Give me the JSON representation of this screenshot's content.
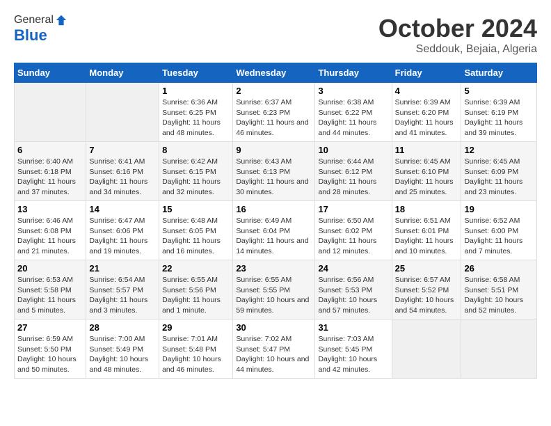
{
  "header": {
    "logo_line1": "General",
    "logo_line2": "Blue",
    "month": "October 2024",
    "location": "Seddouk, Bejaia, Algeria"
  },
  "days_of_week": [
    "Sunday",
    "Monday",
    "Tuesday",
    "Wednesday",
    "Thursday",
    "Friday",
    "Saturday"
  ],
  "weeks": [
    [
      {
        "day": "",
        "sunrise": "",
        "sunset": "",
        "daylight": ""
      },
      {
        "day": "",
        "sunrise": "",
        "sunset": "",
        "daylight": ""
      },
      {
        "day": "1",
        "sunrise": "Sunrise: 6:36 AM",
        "sunset": "Sunset: 6:25 PM",
        "daylight": "Daylight: 11 hours and 48 minutes."
      },
      {
        "day": "2",
        "sunrise": "Sunrise: 6:37 AM",
        "sunset": "Sunset: 6:23 PM",
        "daylight": "Daylight: 11 hours and 46 minutes."
      },
      {
        "day": "3",
        "sunrise": "Sunrise: 6:38 AM",
        "sunset": "Sunset: 6:22 PM",
        "daylight": "Daylight: 11 hours and 44 minutes."
      },
      {
        "day": "4",
        "sunrise": "Sunrise: 6:39 AM",
        "sunset": "Sunset: 6:20 PM",
        "daylight": "Daylight: 11 hours and 41 minutes."
      },
      {
        "day": "5",
        "sunrise": "Sunrise: 6:39 AM",
        "sunset": "Sunset: 6:19 PM",
        "daylight": "Daylight: 11 hours and 39 minutes."
      }
    ],
    [
      {
        "day": "6",
        "sunrise": "Sunrise: 6:40 AM",
        "sunset": "Sunset: 6:18 PM",
        "daylight": "Daylight: 11 hours and 37 minutes."
      },
      {
        "day": "7",
        "sunrise": "Sunrise: 6:41 AM",
        "sunset": "Sunset: 6:16 PM",
        "daylight": "Daylight: 11 hours and 34 minutes."
      },
      {
        "day": "8",
        "sunrise": "Sunrise: 6:42 AM",
        "sunset": "Sunset: 6:15 PM",
        "daylight": "Daylight: 11 hours and 32 minutes."
      },
      {
        "day": "9",
        "sunrise": "Sunrise: 6:43 AM",
        "sunset": "Sunset: 6:13 PM",
        "daylight": "Daylight: 11 hours and 30 minutes."
      },
      {
        "day": "10",
        "sunrise": "Sunrise: 6:44 AM",
        "sunset": "Sunset: 6:12 PM",
        "daylight": "Daylight: 11 hours and 28 minutes."
      },
      {
        "day": "11",
        "sunrise": "Sunrise: 6:45 AM",
        "sunset": "Sunset: 6:10 PM",
        "daylight": "Daylight: 11 hours and 25 minutes."
      },
      {
        "day": "12",
        "sunrise": "Sunrise: 6:45 AM",
        "sunset": "Sunset: 6:09 PM",
        "daylight": "Daylight: 11 hours and 23 minutes."
      }
    ],
    [
      {
        "day": "13",
        "sunrise": "Sunrise: 6:46 AM",
        "sunset": "Sunset: 6:08 PM",
        "daylight": "Daylight: 11 hours and 21 minutes."
      },
      {
        "day": "14",
        "sunrise": "Sunrise: 6:47 AM",
        "sunset": "Sunset: 6:06 PM",
        "daylight": "Daylight: 11 hours and 19 minutes."
      },
      {
        "day": "15",
        "sunrise": "Sunrise: 6:48 AM",
        "sunset": "Sunset: 6:05 PM",
        "daylight": "Daylight: 11 hours and 16 minutes."
      },
      {
        "day": "16",
        "sunrise": "Sunrise: 6:49 AM",
        "sunset": "Sunset: 6:04 PM",
        "daylight": "Daylight: 11 hours and 14 minutes."
      },
      {
        "day": "17",
        "sunrise": "Sunrise: 6:50 AM",
        "sunset": "Sunset: 6:02 PM",
        "daylight": "Daylight: 11 hours and 12 minutes."
      },
      {
        "day": "18",
        "sunrise": "Sunrise: 6:51 AM",
        "sunset": "Sunset: 6:01 PM",
        "daylight": "Daylight: 11 hours and 10 minutes."
      },
      {
        "day": "19",
        "sunrise": "Sunrise: 6:52 AM",
        "sunset": "Sunset: 6:00 PM",
        "daylight": "Daylight: 11 hours and 7 minutes."
      }
    ],
    [
      {
        "day": "20",
        "sunrise": "Sunrise: 6:53 AM",
        "sunset": "Sunset: 5:58 PM",
        "daylight": "Daylight: 11 hours and 5 minutes."
      },
      {
        "day": "21",
        "sunrise": "Sunrise: 6:54 AM",
        "sunset": "Sunset: 5:57 PM",
        "daylight": "Daylight: 11 hours and 3 minutes."
      },
      {
        "day": "22",
        "sunrise": "Sunrise: 6:55 AM",
        "sunset": "Sunset: 5:56 PM",
        "daylight": "Daylight: 11 hours and 1 minute."
      },
      {
        "day": "23",
        "sunrise": "Sunrise: 6:55 AM",
        "sunset": "Sunset: 5:55 PM",
        "daylight": "Daylight: 10 hours and 59 minutes."
      },
      {
        "day": "24",
        "sunrise": "Sunrise: 6:56 AM",
        "sunset": "Sunset: 5:53 PM",
        "daylight": "Daylight: 10 hours and 57 minutes."
      },
      {
        "day": "25",
        "sunrise": "Sunrise: 6:57 AM",
        "sunset": "Sunset: 5:52 PM",
        "daylight": "Daylight: 10 hours and 54 minutes."
      },
      {
        "day": "26",
        "sunrise": "Sunrise: 6:58 AM",
        "sunset": "Sunset: 5:51 PM",
        "daylight": "Daylight: 10 hours and 52 minutes."
      }
    ],
    [
      {
        "day": "27",
        "sunrise": "Sunrise: 6:59 AM",
        "sunset": "Sunset: 5:50 PM",
        "daylight": "Daylight: 10 hours and 50 minutes."
      },
      {
        "day": "28",
        "sunrise": "Sunrise: 7:00 AM",
        "sunset": "Sunset: 5:49 PM",
        "daylight": "Daylight: 10 hours and 48 minutes."
      },
      {
        "day": "29",
        "sunrise": "Sunrise: 7:01 AM",
        "sunset": "Sunset: 5:48 PM",
        "daylight": "Daylight: 10 hours and 46 minutes."
      },
      {
        "day": "30",
        "sunrise": "Sunrise: 7:02 AM",
        "sunset": "Sunset: 5:47 PM",
        "daylight": "Daylight: 10 hours and 44 minutes."
      },
      {
        "day": "31",
        "sunrise": "Sunrise: 7:03 AM",
        "sunset": "Sunset: 5:45 PM",
        "daylight": "Daylight: 10 hours and 42 minutes."
      },
      {
        "day": "",
        "sunrise": "",
        "sunset": "",
        "daylight": ""
      },
      {
        "day": "",
        "sunrise": "",
        "sunset": "",
        "daylight": ""
      }
    ]
  ]
}
